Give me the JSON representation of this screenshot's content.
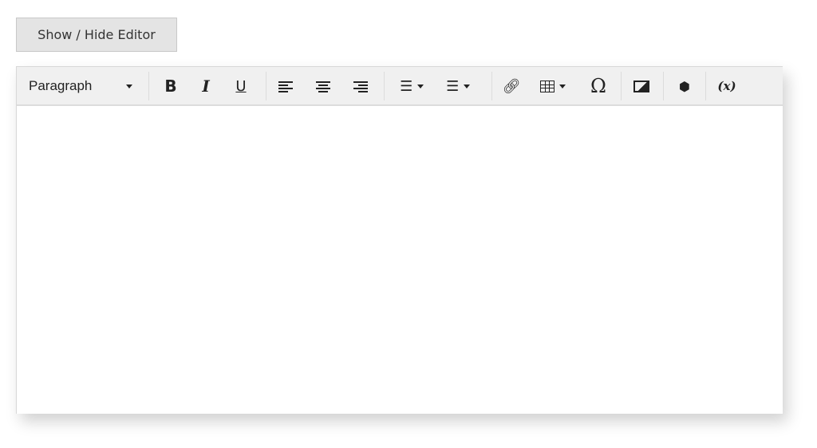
{
  "toggle_button": {
    "label": "Show / Hide Editor"
  },
  "toolbar": {
    "format_select": {
      "value": "Paragraph"
    },
    "bold": "B",
    "italic": "I",
    "underline": "U",
    "special_char": "Ω",
    "variable": "(x)"
  },
  "editor": {
    "content": ""
  }
}
